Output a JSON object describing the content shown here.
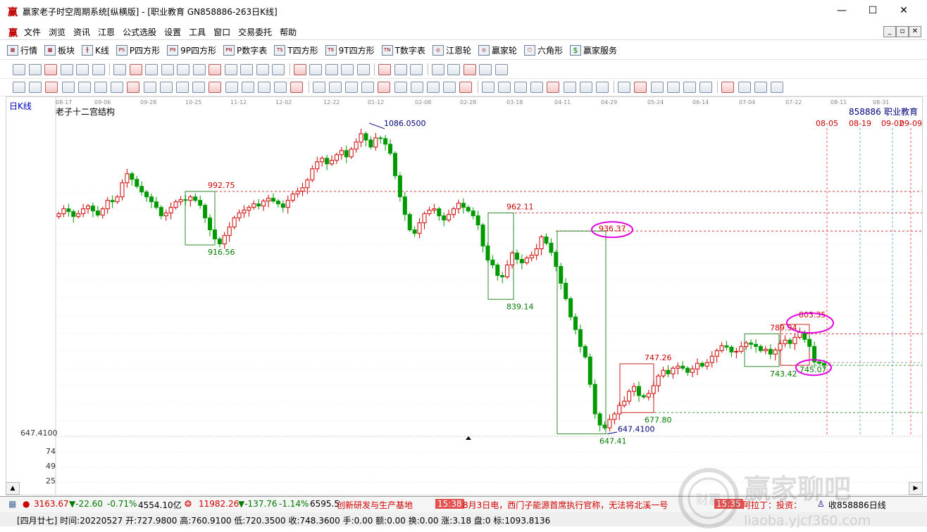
{
  "titlebar": {
    "app_icon": "赢",
    "title": "赢家老子时空周期系统[纵横版] - [职业教育  GN858886-263日K线]",
    "minimize": "—",
    "maximize": "☐",
    "close": "✕"
  },
  "menubar": {
    "logo": "赢",
    "items": [
      "文件",
      "浏览",
      "资讯",
      "江恩",
      "公式选股",
      "设置",
      "工具",
      "窗口",
      "交易委托",
      "帮助"
    ],
    "mdi_buttons": [
      "_",
      "▫",
      "✕"
    ]
  },
  "toolbar": {
    "items": [
      {
        "label": "行情",
        "icon": "grid-icon"
      },
      {
        "label": "板块",
        "icon": "block-icon"
      },
      {
        "label": "K线",
        "icon": "kline-icon"
      },
      {
        "label": "P四方形",
        "icon": "PS"
      },
      {
        "label": "9P四方形",
        "icon": "P9"
      },
      {
        "label": "P数字表",
        "icon": "PN"
      },
      {
        "label": "T四方形",
        "icon": "TS"
      },
      {
        "label": "9T四方形",
        "icon": "T9"
      },
      {
        "label": "T数字表",
        "icon": "TN"
      },
      {
        "label": "江恩轮",
        "icon": "wheel-icon"
      },
      {
        "label": "赢家轮",
        "icon": "wheel-icon"
      },
      {
        "label": "六角形",
        "icon": "hexagon-icon"
      },
      {
        "label": "赢家服务",
        "icon": "dollar-icon"
      }
    ]
  },
  "chart": {
    "period_label": "日K线",
    "indicator_name": "老子十二宫结构",
    "code_label": "858886",
    "name_label": "职业教育",
    "left_axis_label": "647.4100",
    "volume_ticks": [
      "74",
      "49",
      "25"
    ],
    "x_dates": [
      "08-17",
      "09-06",
      "09-28",
      "10-25",
      "11-12",
      "12-02",
      "12-22",
      "01-12",
      "02-08",
      "02-28",
      "03-18",
      "04-11",
      "04-29",
      "05-24",
      "06-14",
      "07-04",
      "07-22",
      "08-11",
      "08-31"
    ],
    "future_dates": [
      "08-05",
      "08-19",
      "09-02",
      "09-09"
    ],
    "levels": [
      {
        "value": "992.75",
        "color": "#cc0000"
      },
      {
        "value": "916.56",
        "color": "#007a00"
      },
      {
        "value": "1086.0500",
        "color": "#000080"
      },
      {
        "value": "962.11",
        "color": "#cc0000"
      },
      {
        "value": "936.37",
        "color": "#cc0000"
      },
      {
        "value": "839.14",
        "color": "#007a00"
      },
      {
        "value": "747.26",
        "color": "#cc0000"
      },
      {
        "value": "677.80",
        "color": "#007a00"
      },
      {
        "value": "647.4100",
        "color": "#000080"
      },
      {
        "value": "647.41",
        "color": "#007a00"
      },
      {
        "value": "789.94",
        "color": "#cc0000"
      },
      {
        "value": "803.35",
        "color": "#cc0000"
      },
      {
        "value": "743.42",
        "color": "#007a00"
      },
      {
        "value": "745.07",
        "color": "#007a00"
      }
    ]
  },
  "statusbar": {
    "index1_value": "3163.67",
    "index1_change": "▼-22.60",
    "index1_pct": "-0.71%",
    "index1_amount": "4554.10亿",
    "index2_value": "11982.26",
    "index2_change": "▼-137.76",
    "index2_pct": "-1.14%",
    "index2_amount": "6595.5",
    "news_tail": "创新研发与生产基地",
    "news_time1": "15:38",
    "news1": "8月3日电，西门子能源首席执行官称，无法将北溪一号",
    "news_time2": "15:35",
    "news2": "阿拉丁：投资：",
    "close_label": "收858886日线"
  },
  "bar_info": {
    "text": "[四月廿七] 时间:20220527 开:727.9800 高:760.9100 低:720.3500 收:748.3600 手:0.00 额:0.00 换:0.00 涨:3.18 盘:0 标:1093.8136"
  },
  "watermark": {
    "brand": "赢家聊吧",
    "url": "liaoba.yjcf360.com",
    "seal": "财赢"
  },
  "colors": {
    "up": "#d00000",
    "down": "#009a00",
    "highlight": "#e000e0",
    "future_red": "#ff5050",
    "future_blue": "#6fa8dc"
  },
  "chart_data": {
    "type": "candlestick",
    "title": "老子十二宫结构",
    "period": "日K线",
    "y_range_approx": [
      640,
      1100
    ],
    "labeled_levels": {
      "high": 1086.05,
      "low": 647.41,
      "resistance": [
        992.75,
        962.11,
        936.37,
        803.35,
        789.94,
        747.26
      ],
      "support": [
        916.56,
        839.14,
        677.8,
        745.07,
        743.42
      ]
    },
    "last_bar": {
      "date": "20220527",
      "open": 727.98,
      "high": 760.91,
      "low": 720.35,
      "close": 748.36
    },
    "closes": [
      961,
      968,
      964,
      957,
      961,
      968,
      972,
      965,
      959,
      968,
      980,
      978,
      985,
      1005,
      1018,
      1010,
      1000,
      992,
      985,
      978,
      970,
      958,
      962,
      970,
      978,
      981,
      980,
      985,
      980,
      973,
      955,
      938,
      925,
      918,
      930,
      942,
      955,
      962,
      966,
      970,
      975,
      972,
      979,
      983,
      979,
      975,
      970,
      980,
      989,
      993,
      998,
      1009,
      1025,
      1035,
      1040,
      1032,
      1037,
      1045,
      1051,
      1042,
      1053,
      1063,
      1075,
      1066,
      1056,
      1069,
      1068,
      1060,
      1047,
      1015,
      985,
      960,
      938,
      933,
      948,
      961,
      966,
      968,
      958,
      952,
      960,
      968,
      976,
      970,
      965,
      958,
      945,
      915,
      895,
      888,
      873,
      871,
      888,
      905,
      896,
      891,
      898,
      902,
      911,
      928,
      919,
      906,
      886,
      862,
      840,
      814,
      796,
      772,
      757,
      718,
      676,
      660,
      656,
      668,
      676,
      688,
      694,
      708,
      715,
      702,
      700,
      705,
      716,
      730,
      738,
      733,
      741,
      744,
      741,
      735,
      740,
      748,
      744,
      749,
      758,
      766,
      773,
      771,
      764,
      765,
      772,
      777,
      775,
      772,
      766,
      768,
      761,
      767,
      776,
      781,
      776,
      785,
      792,
      782,
      772,
      750,
      748,
      745
    ]
  }
}
